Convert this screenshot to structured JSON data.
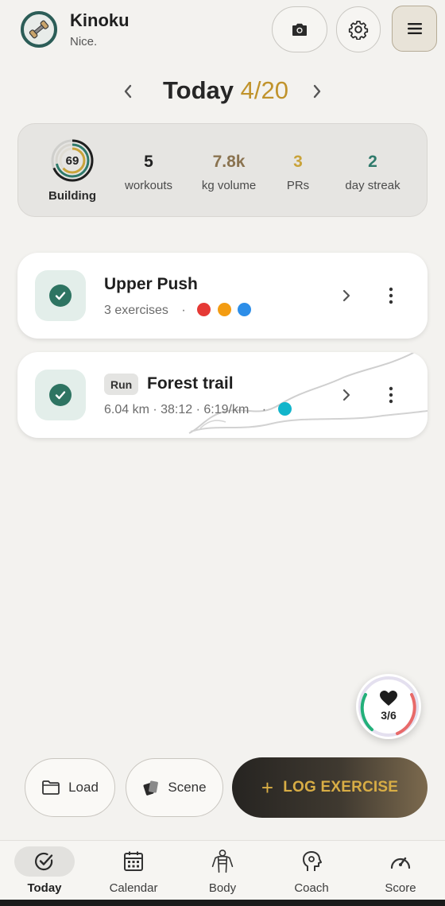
{
  "header": {
    "app_name": "Kinoku",
    "subtitle": "Nice."
  },
  "date_nav": {
    "label": "Today",
    "date": "4/20"
  },
  "stats": {
    "ring_value": "69",
    "ring_label": "Building",
    "items": [
      {
        "value": "5",
        "label": "workouts",
        "color": "#222222"
      },
      {
        "value": "7.8k",
        "label": "kg volume",
        "color": "#8a7350"
      },
      {
        "value": "3",
        "label": "PRs",
        "color": "#c9a33a"
      },
      {
        "value": "2",
        "label": "day streak",
        "color": "#2f7a6b"
      }
    ]
  },
  "workouts": [
    {
      "title": "Upper Push",
      "subtitle": "3 exercises",
      "separator": "·",
      "dot_colors": [
        "#e53935",
        "#f39c12",
        "#2d8ee8"
      ],
      "completed": true
    },
    {
      "badge": "Run",
      "title": "Forest trail",
      "subtitle": "6.04 km · 38:12 · 6:19/km",
      "separator": "·",
      "dot_colors": [
        "#12b5cb"
      ],
      "completed": true
    }
  ],
  "heart_widget": {
    "count": "3/6"
  },
  "actions": {
    "load_label": "Load",
    "scene_label": "Scene",
    "log_label": "LOG EXERCISE",
    "log_icon": "+"
  },
  "nav": {
    "items": [
      {
        "label": "Today",
        "icon": "check-circle-icon",
        "active": true
      },
      {
        "label": "Calendar",
        "icon": "calendar-icon",
        "active": false
      },
      {
        "label": "Body",
        "icon": "body-icon",
        "active": false
      },
      {
        "label": "Coach",
        "icon": "coach-head-icon",
        "active": false
      },
      {
        "label": "Score",
        "icon": "gauge-icon",
        "active": false
      }
    ]
  },
  "colors": {
    "accent_gold": "#c0932c",
    "check_green": "#2e7462",
    "background": "#f3f2ef"
  }
}
